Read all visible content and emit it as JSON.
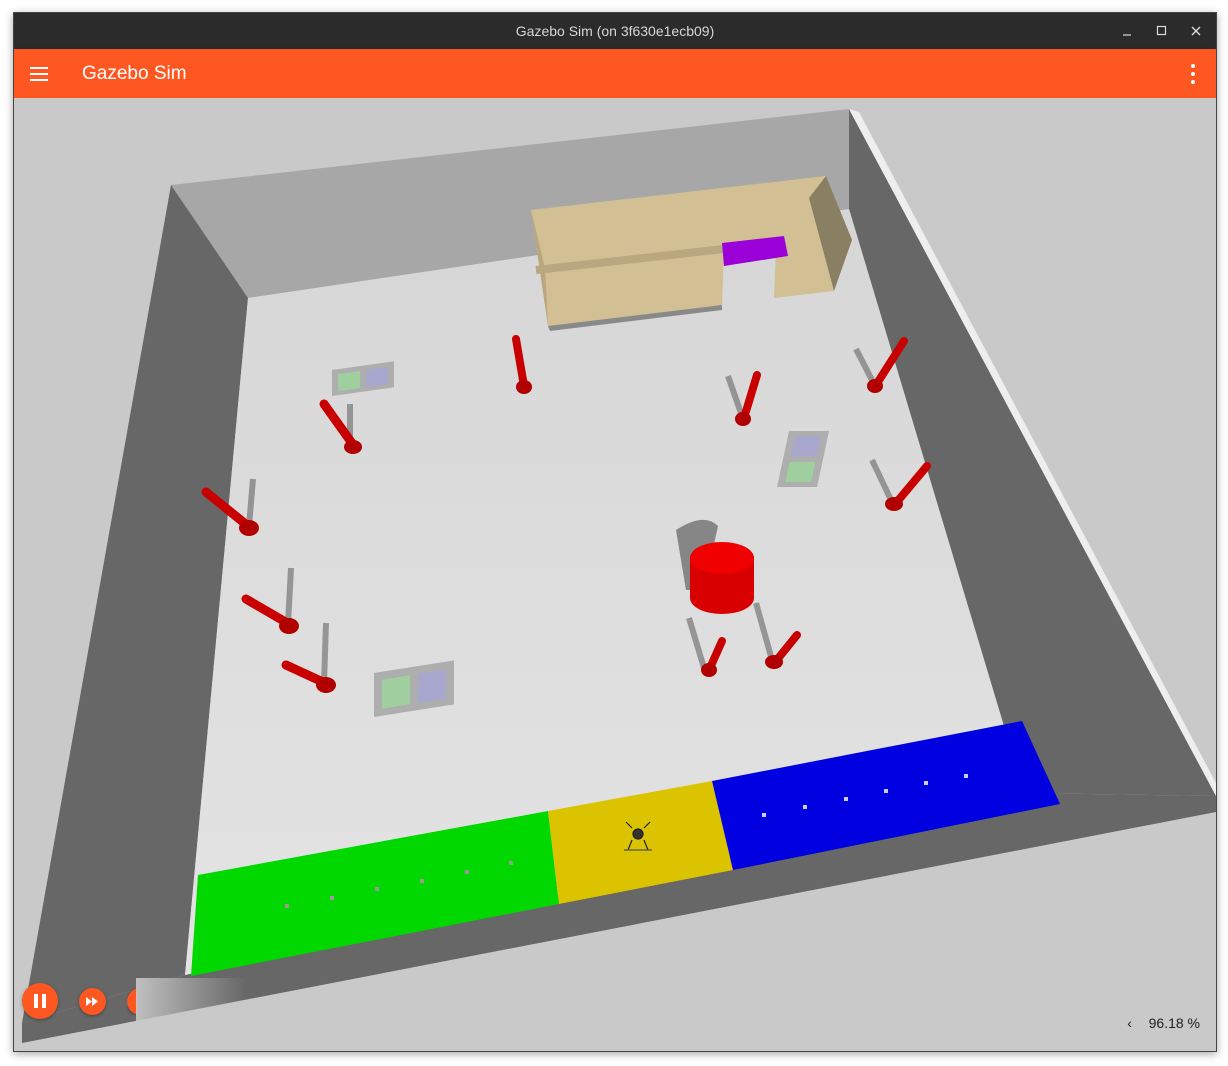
{
  "window": {
    "title": "Gazebo Sim (on 3f630e1ecb09)",
    "controls": {
      "minimize": "–",
      "maximize": "☐",
      "close": "✕"
    }
  },
  "toolbar": {
    "menu_icon": "hamburger-menu-icon",
    "app_name": "Gazebo Sim",
    "overflow_icon": "vertical-ellipsis-icon",
    "accent_color": "#fe5722"
  },
  "world_controls": {
    "play_pause_icon": "pause-icon",
    "step_icon": "fast-forward-icon"
  },
  "stats": {
    "expand_icon": "chevron-left-icon",
    "real_time_factor": "96.18 %"
  },
  "scene": {
    "objects": [
      "walls",
      "shelf",
      "red-posts",
      "red-cylinder",
      "marker-pads",
      "green-zone",
      "yellow-zone",
      "blue-zone",
      "drone"
    ],
    "zone_colors": {
      "green": "#00d800",
      "yellow": "#dcc300",
      "blue": "#0000e0",
      "posts": "#d20000",
      "cylinder": "#e00000",
      "purple": "#9a00d8"
    }
  }
}
